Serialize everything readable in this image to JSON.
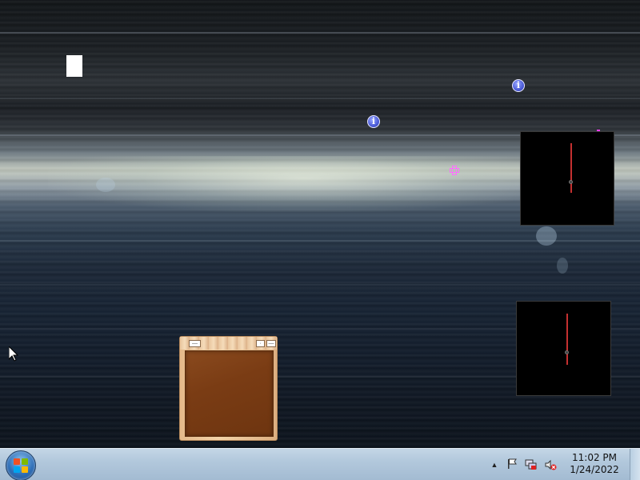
{
  "taskbar": {
    "start_label": "Start",
    "clock_time": "11:02 PM",
    "clock_date": "1/24/2022",
    "tray_icons": [
      "show-hidden-icons-arrow",
      "action-center-flag-icon",
      "network-icon",
      "volume-muted-icon"
    ]
  },
  "colors": {
    "taskbar": "#b2c8dc",
    "clock_hand": "#c43030",
    "wood_panel": "#7a3c14",
    "info_icon": "#4c5cd8",
    "marker": "#ff3cff"
  },
  "desktop": {
    "gadgets": [
      "clock-gadget-top",
      "clock-gadget-bottom",
      "wood-notes-gadget"
    ]
  }
}
